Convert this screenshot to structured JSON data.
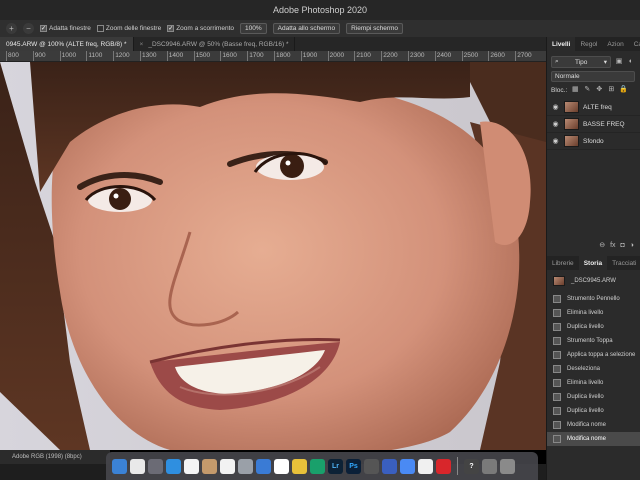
{
  "window": {
    "title": "Adobe Photoshop 2020"
  },
  "options_bar": {
    "zoom_in_icon": "zoom-in-icon",
    "zoom_out_icon": "zoom-out-icon",
    "resize_windows": {
      "label": "Adatta finestre",
      "checked": true
    },
    "zoom_all_windows": {
      "label": "Zoom delle finestre",
      "checked": false
    },
    "scrubby_zoom": {
      "label": "Zoom a scorrimento",
      "checked": true
    },
    "zoom_level": "100%",
    "fit_screen": "Adatta allo schermo",
    "fill_screen": "Riempi schermo"
  },
  "document_tabs": [
    {
      "label": "0945.ARW @ 100% (ALTE freq, RGB/8) *",
      "active": true
    },
    {
      "label": "_DSC9946.ARW @ 50% (Basse freq, RGB/16) *",
      "active": false
    }
  ],
  "ruler": {
    "ticks": [
      "800",
      "900",
      "1000",
      "1100",
      "1200",
      "1300",
      "1400",
      "1500",
      "1600",
      "1700",
      "1800",
      "1900",
      "2000",
      "2100",
      "2200",
      "2300",
      "2400",
      "2500",
      "2600",
      "2700"
    ]
  },
  "status": {
    "profile": "Adobe RGB (1998) (8bpc)"
  },
  "layers_panel": {
    "tabs": [
      {
        "label": "Livelli",
        "active": true
      },
      {
        "label": "Regol",
        "active": false
      },
      {
        "label": "Azion",
        "active": false
      },
      {
        "label": "Canal",
        "active": false
      }
    ],
    "filter_label": "Tipo",
    "blend_mode": "Normale",
    "lock_label": "Bloc.:",
    "layers": [
      {
        "name": "ALTE freq",
        "selected": false
      },
      {
        "name": "BASSE FREQ",
        "selected": false
      },
      {
        "name": "Sfondo",
        "selected": false
      }
    ]
  },
  "history_panel": {
    "tabs": [
      {
        "label": "Librerie",
        "active": false
      },
      {
        "label": "Storia",
        "active": true
      },
      {
        "label": "Tracciati",
        "active": false
      }
    ],
    "snapshot": "_DSC9945.ARW",
    "items": [
      "Strumento Pennello",
      "Elimina livello",
      "Duplica livello",
      "Strumento Toppa",
      "Applica toppa a selezione",
      "Deseleziona",
      "Elimina livello",
      "Duplica livello",
      "Duplica livello",
      "Modifica nome",
      "Modifica nome"
    ],
    "selected_index": 10
  },
  "dock": {
    "apps": [
      {
        "icon": "finder-icon",
        "color": "#3b82d6",
        "label": ""
      },
      {
        "icon": "calendar-icon",
        "color": "#e9e9e9",
        "label": ""
      },
      {
        "icon": "launchpad-icon",
        "color": "#6b6b75",
        "label": ""
      },
      {
        "icon": "safari-icon",
        "color": "#2f8fe0",
        "label": ""
      },
      {
        "icon": "photos-icon",
        "color": "#f5f5f5",
        "label": ""
      },
      {
        "icon": "contacts-icon",
        "color": "#c49a6c",
        "label": ""
      },
      {
        "icon": "music-icon",
        "color": "#f2f2f2",
        "label": ""
      },
      {
        "icon": "preview-icon",
        "color": "#9aa0a8",
        "label": ""
      },
      {
        "icon": "keynote-icon",
        "color": "#3a7bd5",
        "label": ""
      },
      {
        "icon": "calendar2-icon",
        "color": "#ffffff",
        "label": ""
      },
      {
        "icon": "notes-icon",
        "color": "#e8c13a",
        "label": ""
      },
      {
        "icon": "clock-icon",
        "color": "#19a06b",
        "label": ""
      },
      {
        "icon": "lightroom-icon",
        "color": "#0d2236",
        "label": "Lr"
      },
      {
        "icon": "photoshop-icon",
        "color": "#0b2038",
        "label": "Ps"
      },
      {
        "icon": "metadata-icon",
        "color": "#555555",
        "label": ""
      },
      {
        "icon": "affinity-icon",
        "color": "#3a5fbf",
        "label": ""
      },
      {
        "icon": "chrome-icon",
        "color": "#4a8af4",
        "label": ""
      },
      {
        "icon": "word-icon",
        "color": "#f0f0f0",
        "label": ""
      },
      {
        "icon": "creative-cloud-icon",
        "color": "#d8262b",
        "label": ""
      },
      {
        "icon": "help-icon",
        "color": "#444",
        "label": "?"
      },
      {
        "icon": "folder-icon",
        "color": "#7a7a7a",
        "label": ""
      },
      {
        "icon": "trash-icon",
        "color": "#8a8a8a",
        "label": ""
      }
    ]
  }
}
